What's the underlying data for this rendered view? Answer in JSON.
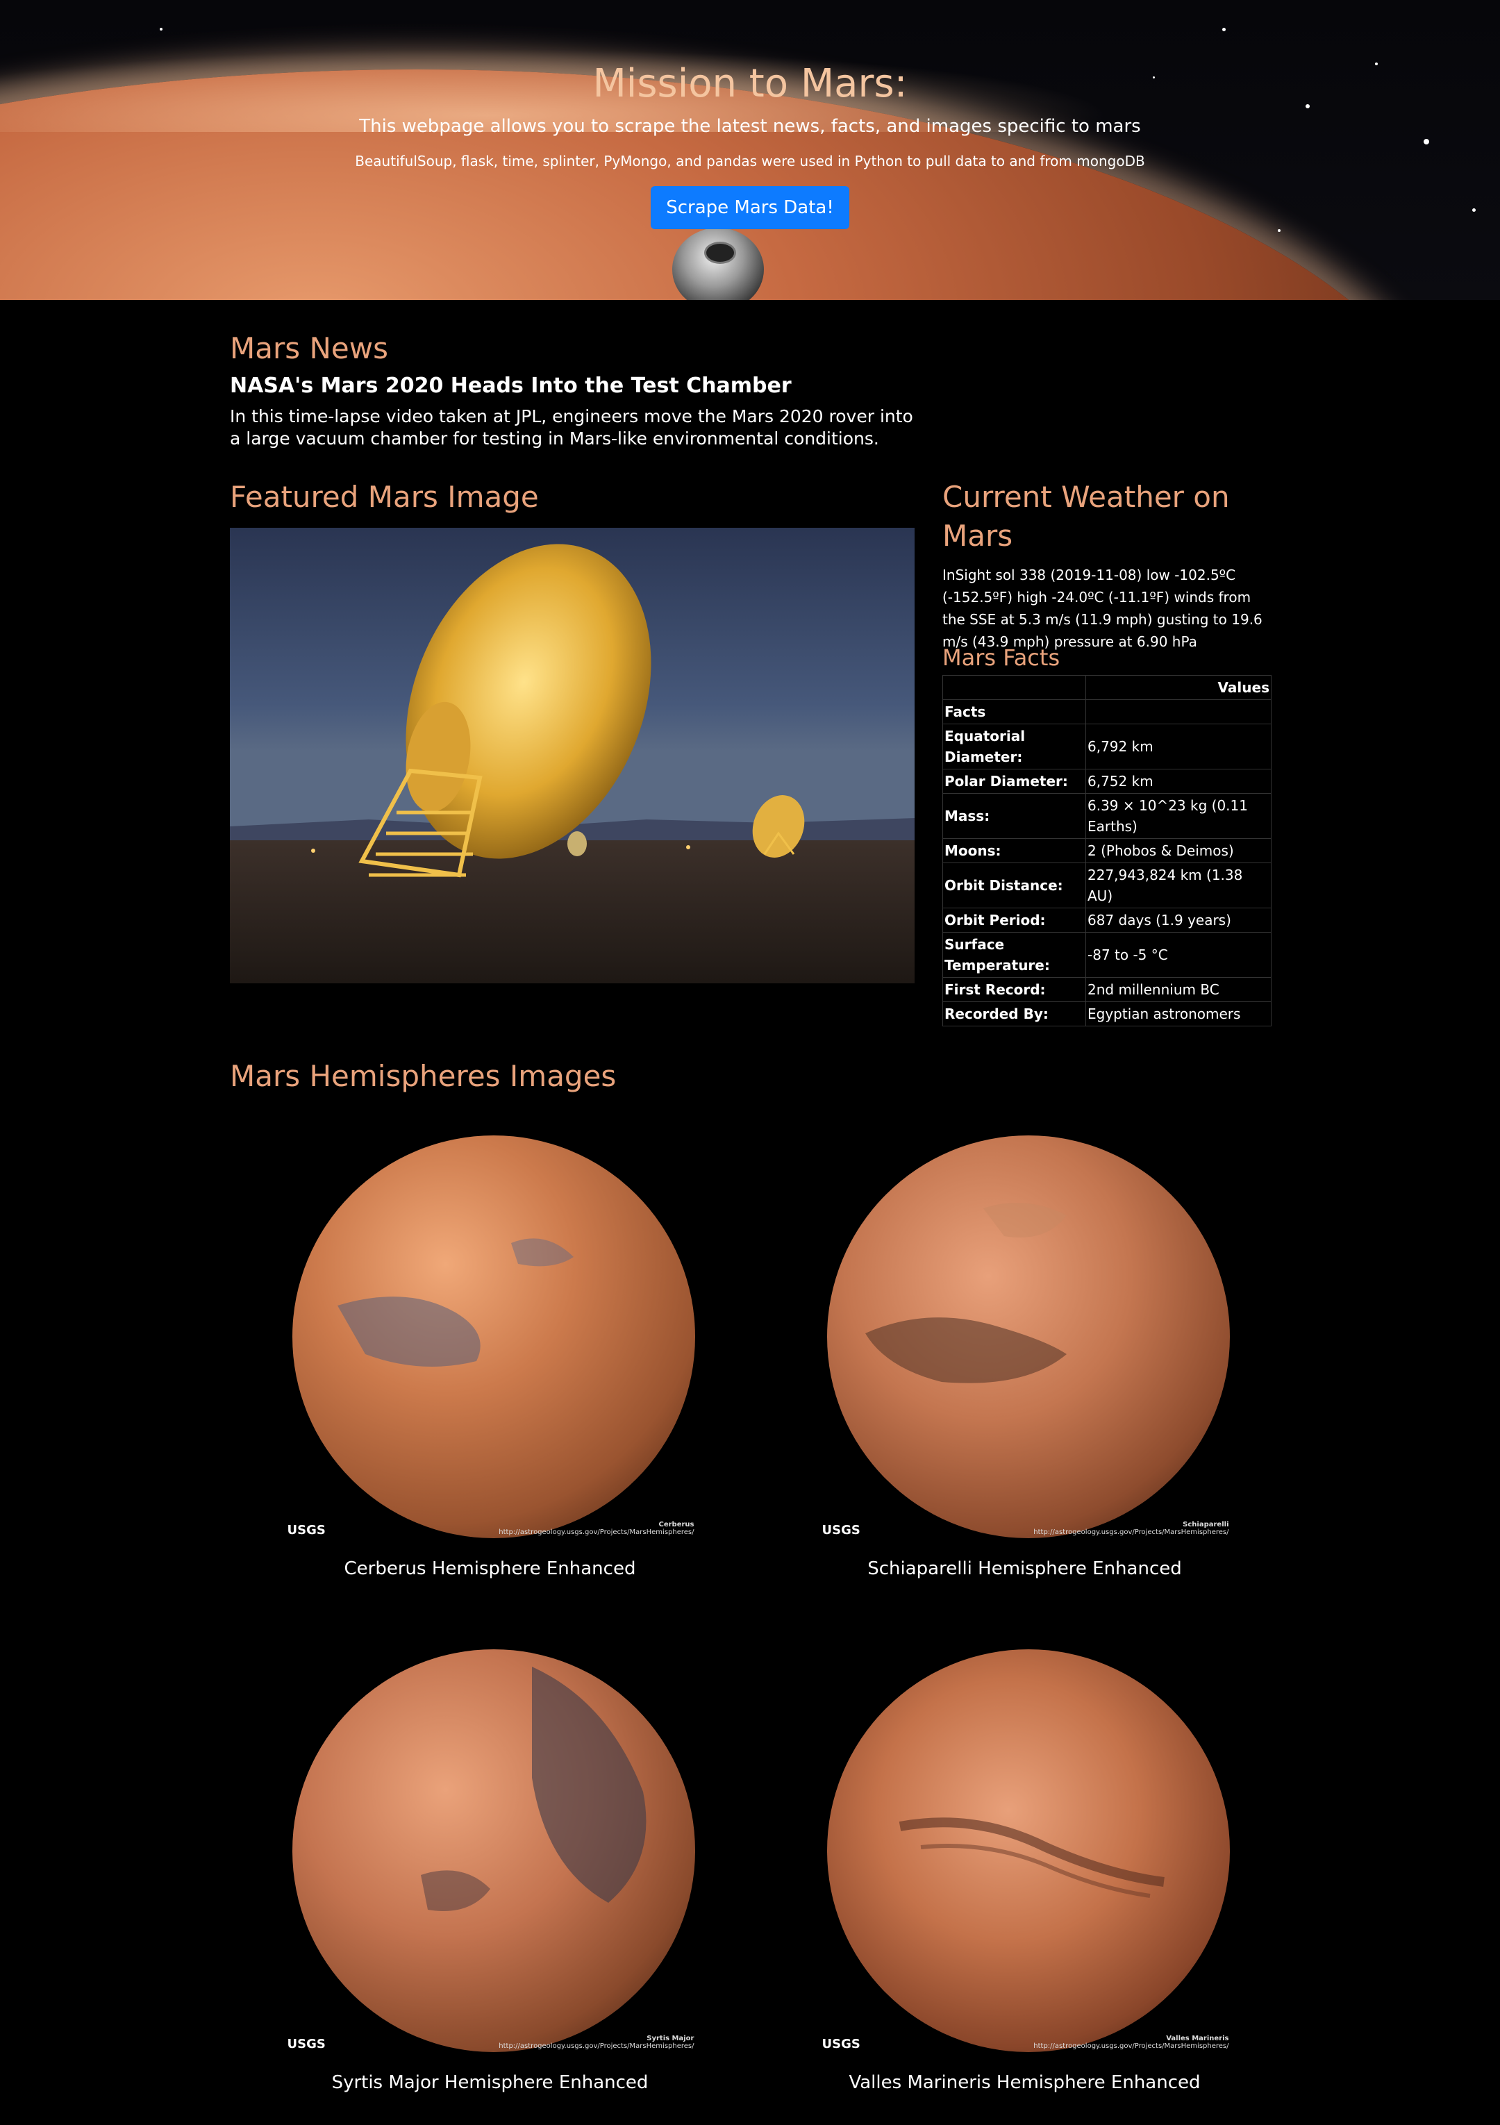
{
  "hero": {
    "title": "Mission to Mars:",
    "subtitle": "This webpage allows you to scrape the latest news, facts, and images specific to mars",
    "tech_line": "BeautifulSoup, flask, time, splinter, PyMongo, and pandas were used in Python to pull data to and from mongoDB",
    "button_label": "Scrape Mars Data!"
  },
  "news": {
    "heading": "Mars News",
    "title": "NASA's Mars 2020 Heads Into the Test Chamber",
    "body": "In this time-lapse video taken at JPL, engineers move the Mars 2020 rover into a large vacuum chamber for testing in Mars-like environmental conditions."
  },
  "featured": {
    "heading": "Featured Mars Image"
  },
  "weather": {
    "heading": "Current Weather on Mars",
    "text": "InSight sol 338 (2019-11-08) low -102.5ºC (-152.5ºF) high -24.0ºC (-11.1ºF) winds from the SSE at 5.3 m/s (11.9 mph) gusting to 19.6 m/s (43.9 mph) pressure at 6.90 hPa"
  },
  "facts": {
    "heading": "Mars Facts",
    "col_header": "Values",
    "index_label": "Facts",
    "rows": [
      {
        "k": "Equatorial Diameter:",
        "v": "6,792 km"
      },
      {
        "k": "Polar Diameter:",
        "v": "6,752 km"
      },
      {
        "k": "Mass:",
        "v": "6.39 × 10^23 kg (0.11 Earths)"
      },
      {
        "k": "Moons:",
        "v": "2 (Phobos & Deimos)"
      },
      {
        "k": "Orbit Distance:",
        "v": "227,943,824 km (1.38 AU)"
      },
      {
        "k": "Orbit Period:",
        "v": "687 days (1.9 years)"
      },
      {
        "k": "Surface Temperature:",
        "v": "-87 to -5 °C"
      },
      {
        "k": "First Record:",
        "v": "2nd millennium BC"
      },
      {
        "k": "Recorded By:",
        "v": "Egyptian astronomers"
      }
    ]
  },
  "hemispheres": {
    "heading": "Mars Hemispheres Images",
    "usgs_label": "USGS",
    "items": [
      {
        "title": "Cerberus Hemisphere Enhanced",
        "tag": "Cerberus",
        "credit": "http://astrogeology.usgs.gov/Projects/MarsHemispheres/"
      },
      {
        "title": "Schiaparelli Hemisphere Enhanced",
        "tag": "Schiaparelli",
        "credit": "http://astrogeology.usgs.gov/Projects/MarsHemispheres/"
      },
      {
        "title": "Syrtis Major Hemisphere Enhanced",
        "tag": "Syrtis Major",
        "credit": "http://astrogeology.usgs.gov/Projects/MarsHemispheres/"
      },
      {
        "title": "Valles Marineris Hemisphere Enhanced",
        "tag": "Valles Marineris",
        "credit": "http://astrogeology.usgs.gov/Projects/MarsHemispheres/"
      }
    ]
  }
}
